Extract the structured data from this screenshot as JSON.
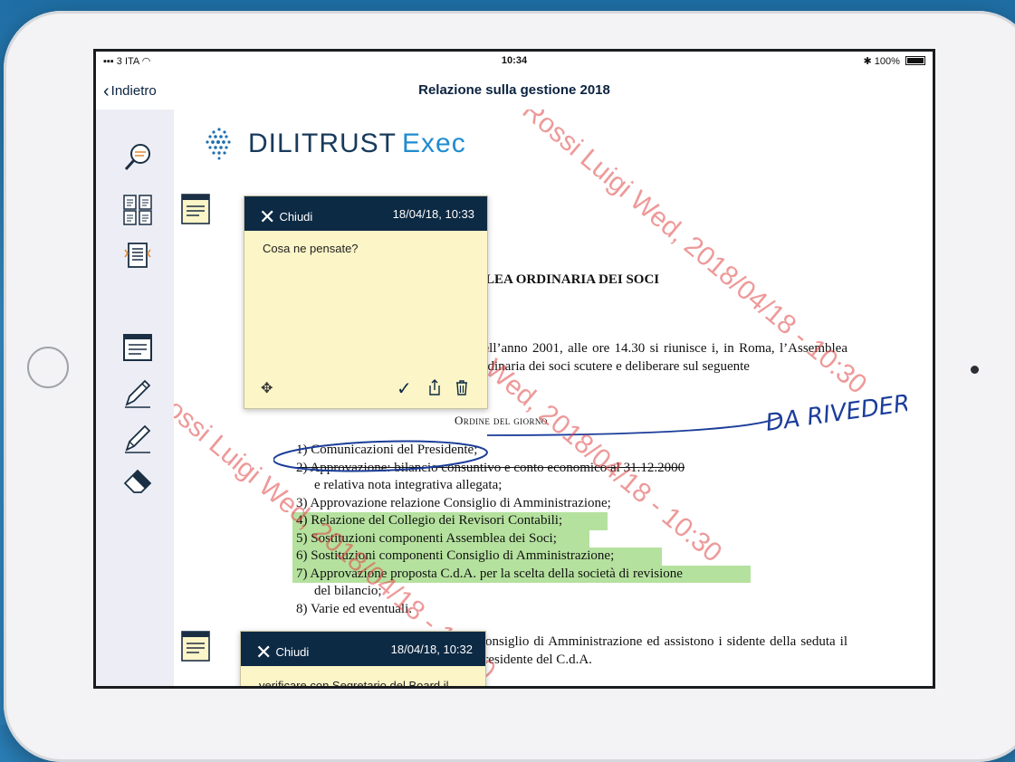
{
  "status": {
    "carrier": "3 ITA",
    "time": "10:34",
    "battery": "100%"
  },
  "nav": {
    "back_label": "Indietro",
    "title": "Relazione sulla gestione 2018"
  },
  "logo": {
    "brand": "DILITRUST",
    "product": "Exec"
  },
  "document": {
    "heading": "BLEA ORDINARIA DEI SOCI",
    "paragraph": "dell’anno 2001, alle ore 14.30 si riunisce i, in Roma, l’Assemblea ordinaria dei soci scutere e deliberare sul seguente",
    "agenda_title": "Ordine del giorno",
    "agenda": [
      {
        "text": "1) Comunicazioni del Presidente;",
        "highlight": false
      },
      {
        "text": "2) Approvazione: bilancio consuntivo e conto economico al 31.12.2000",
        "highlight": false,
        "strike": true
      },
      {
        "text": "e relativa nota integrativa allegata;",
        "highlight": false,
        "indent": true
      },
      {
        "text": "3) Approvazione relazione Consiglio di Amministrazione;",
        "highlight": false
      },
      {
        "text": "4) Relazione del Collegio dei Revisori Contabili;",
        "highlight": true
      },
      {
        "text": "5) Sostituzioni componenti Assemblea dei Soci;",
        "highlight": true
      },
      {
        "text": "6) Sostituzioni componenti Consiglio di Amministrazione;",
        "highlight": true
      },
      {
        "text": "7) Approvazione proposta C.d.A. per la scelta della società di revisione",
        "highlight": true
      },
      {
        "text": "del bilancio;",
        "highlight": false,
        "indent": true
      },
      {
        "text": "8) Varie ed eventuali.",
        "highlight": false
      }
    ],
    "paragraph2": "Consiglio di Amministrazione ed assistono i sidente della seduta il Presidente del C.d.A.",
    "handwriting": "DA RIVEDERE!"
  },
  "watermark": "Rossi Luigi Wed, 2018/04/18 - 10:30",
  "notes": [
    {
      "close_label": "Chiudi",
      "date": "18/04/18, 10:33",
      "text": "Cosa ne pensate?"
    },
    {
      "close_label": "Chiudi",
      "date": "18/04/18, 10:32",
      "text": "verificare con Segretario del Board il"
    }
  ],
  "colors": {
    "nav_dark": "#0d2a44",
    "note_bg": "#fcf5c7",
    "highlight": "#b5e19e",
    "watermark": "#e04646",
    "sidebar": "#edeef5"
  }
}
